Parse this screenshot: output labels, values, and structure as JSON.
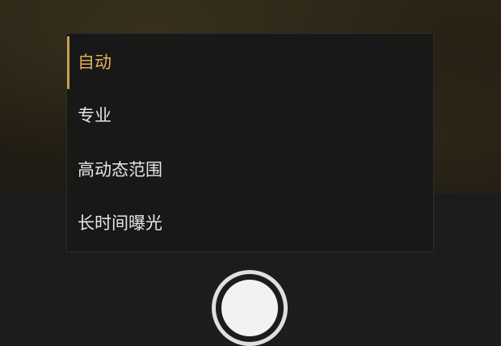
{
  "mode_menu": {
    "items": [
      {
        "label": "自动",
        "active": true
      },
      {
        "label": "专业",
        "active": false
      },
      {
        "label": "高动态范围",
        "active": false
      },
      {
        "label": "长时间曝光",
        "active": false
      }
    ],
    "accent_color": "#d9b25a"
  },
  "shutter": {
    "icon": "shutter-button-icon"
  }
}
